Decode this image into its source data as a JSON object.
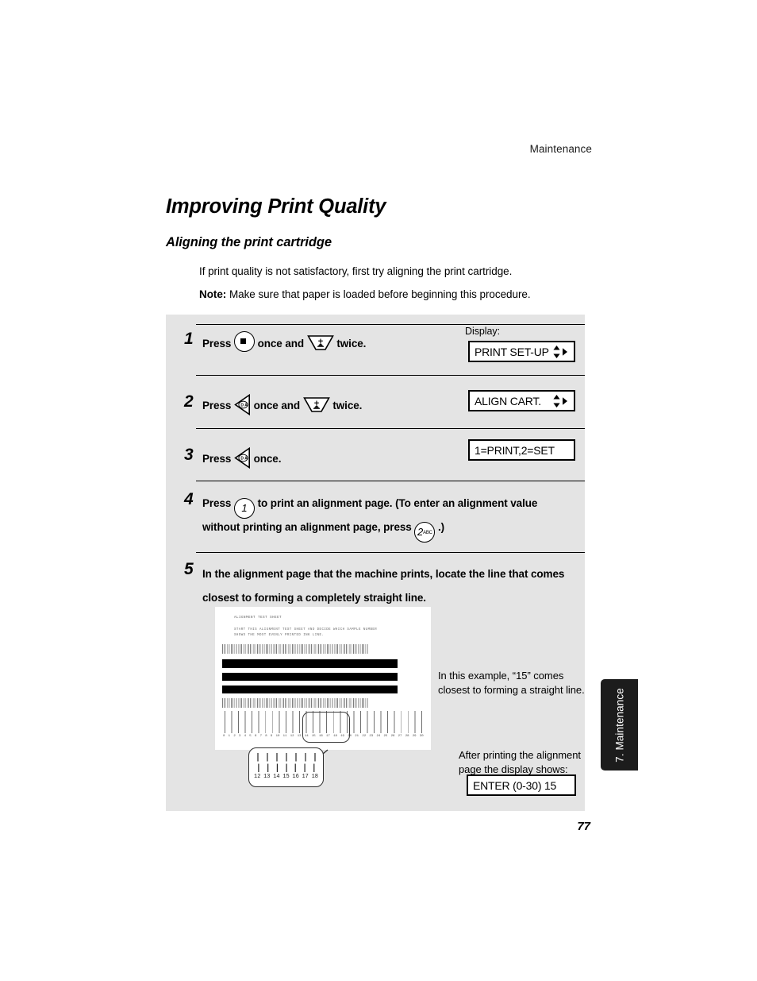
{
  "page": {
    "running_header": "Maintenance",
    "chapter_title": "Improving Print Quality",
    "section_title": "Aligning the print cartridge",
    "intro_paragraph": "If print quality is not satisfactory, first try aligning the print cartridge.",
    "note_label": "Note:",
    "note_text": " Make sure that paper is loaded before beginning this procedure.",
    "page_number": "77"
  },
  "thumb_tab": {
    "label": "7. Maintenance"
  },
  "steps": [
    {
      "number": "1",
      "text_before": "Press",
      "text_middle": "once and",
      "text_after": "twice.",
      "key_1": "function-key",
      "key_2": "down-arrow-key"
    },
    {
      "number": "2",
      "text_before": "Press",
      "text_middle": "once and",
      "text_after": "twice.",
      "key_1": "start-key",
      "key_2": "down-arrow-key"
    },
    {
      "number": "3",
      "text_before": "Press",
      "text_after": "once.",
      "key_1": "start-key"
    },
    {
      "number": "4",
      "line1_before": "Press",
      "line1_after": "to print an alignment page. (To enter an alignment value",
      "line2_before": "without printing an alignment page, press",
      "line2_after": ".)",
      "key_1": "numeric-key-1",
      "key_1_label": "1",
      "key_2": "numeric-key-2",
      "key_2_label": "2",
      "key_2_sub": "ABC"
    },
    {
      "number": "5",
      "text": "In the alignment page that the machine prints, locate the line that comes closest to forming a completely straight line."
    }
  ],
  "displays": {
    "label": "Display:",
    "box_1": {
      "text": "PRINT SET-UP",
      "arrows": "up-down-right"
    },
    "box_2": {
      "text": "ALIGN CART.",
      "arrows": "up-down-right"
    },
    "box_3": {
      "text": "1=PRINT,2=SET",
      "arrows": "none"
    },
    "box_4": {
      "text": "ENTER (0-30) 15",
      "arrows": "none"
    }
  },
  "test_sheet": {
    "heading": "ALIGNMENT TEST SHEET",
    "body_line1": "START THIS ALIGNMENT TEST SHEET AND DECIDE WHICH SAMPLE NUMBER",
    "body_line2": "SHOWS THE MOST EVENLY PRINTED INK LINE.",
    "scale_labels": [
      "0",
      "1",
      "2",
      "3",
      "4",
      "5",
      "6",
      "7",
      "8",
      "9",
      "10",
      "11",
      "12",
      "13",
      "14",
      "15",
      "16",
      "17",
      "18",
      "19",
      "20",
      "21",
      "22",
      "23",
      "24",
      "25",
      "26",
      "27",
      "28",
      "29",
      "30"
    ],
    "highlighted_range": "12-18"
  },
  "callout": {
    "numbers": [
      "12",
      "13",
      "14",
      "15",
      "16",
      "17",
      "18"
    ],
    "best_value": "15"
  },
  "annotations": {
    "example_note": "In this example, “15” comes closest to forming a straight line.",
    "after_print_note": "After printing the alignment page the display shows:"
  },
  "colors": {
    "panel_bg": "#e4e4e4",
    "tab_bg": "#1c1c1c",
    "text": "#000000"
  }
}
